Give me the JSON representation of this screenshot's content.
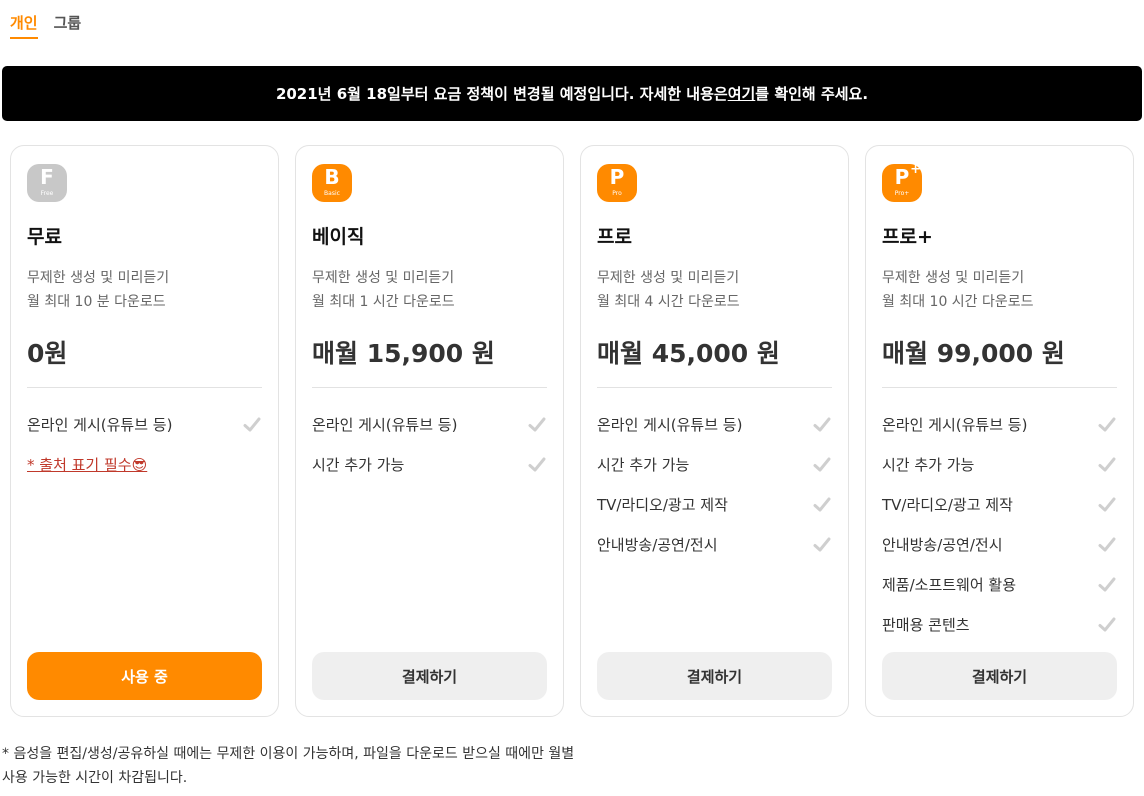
{
  "tabs": [
    "개인",
    "그룹"
  ],
  "notice": {
    "before": "2021년 6월 18일부터 요금 정책이 변경될 예정입니다. 자세한 내용은 ",
    "link": "여기",
    "after": "를 확인해 주세요."
  },
  "plans": [
    {
      "badge": {
        "letter": "F",
        "sub": "Free",
        "color": "#c8c8c8"
      },
      "name": "무료",
      "desc": [
        "무제한 생성 및 미리듣기",
        "월 최대 10 분 다운로드"
      ],
      "price": "0원",
      "features": [
        "온라인 게시(유튜브 등)"
      ],
      "note": "* 출처 표기 필수😎",
      "cta": "사용 중"
    },
    {
      "badge": {
        "letter": "B",
        "sub": "Basic",
        "color": "#ff8a00"
      },
      "name": "베이직",
      "desc": [
        "무제한 생성 및 미리듣기",
        "월 최대 1 시간 다운로드"
      ],
      "price": "매월 15,900 원",
      "features": [
        "온라인 게시(유튜브 등)",
        "시간 추가 가능"
      ],
      "cta": "결제하기"
    },
    {
      "badge": {
        "letter": "P",
        "sub": "Pro",
        "color": "#ff8a00"
      },
      "name": "프로",
      "desc": [
        "무제한 생성 및 미리듣기",
        "월 최대 4 시간 다운로드"
      ],
      "price": "매월 45,000 원",
      "features": [
        "온라인 게시(유튜브 등)",
        "시간 추가 가능",
        "TV/라디오/광고 제작",
        "안내방송/공연/전시"
      ],
      "cta": "결제하기"
    },
    {
      "badge": {
        "letter": "P",
        "sub": "Pro+",
        "color": "#ff8a00",
        "plus": "+"
      },
      "name": "프로+",
      "desc": [
        "무제한 생성 및 미리듣기",
        "월 최대 10 시간 다운로드"
      ],
      "price": "매월 99,000 원",
      "features": [
        "온라인 게시(유튜브 등)",
        "시간 추가 가능",
        "TV/라디오/광고 제작",
        "안내방송/공연/전시",
        "제품/소프트웨어 활용",
        "판매용 콘텐츠"
      ],
      "cta": "결제하기"
    }
  ],
  "footnote": [
    "* 음성을 편집/생성/공유하실 때에는 무제한 이용이 가능하며, 파일을 다운로드 받으실 때에만 월별",
    "사용 가능한 시간이 차감됩니다."
  ],
  "colors": {
    "accent": "#ff8a00",
    "check": "#cfcfcf",
    "note": "#c0392b"
  }
}
